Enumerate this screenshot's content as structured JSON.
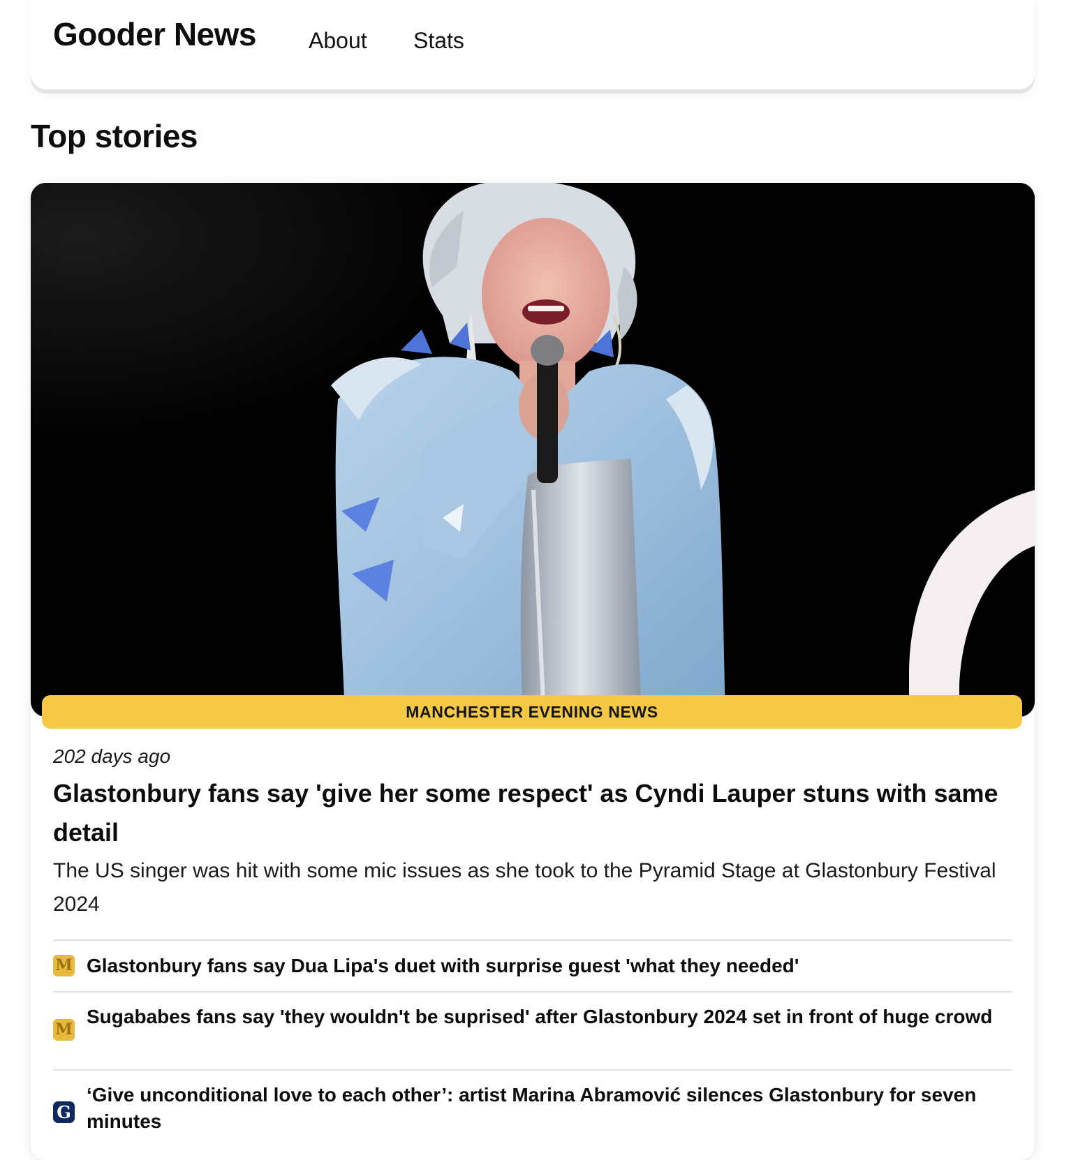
{
  "nav": {
    "brand": "Gooder News",
    "links": [
      "About",
      "Stats"
    ]
  },
  "section": {
    "title": "Top stories"
  },
  "story": {
    "source": "MANCHESTER EVENING NEWS",
    "age": "202 days ago",
    "headline": "Glastonbury fans say 'give her some respect' as Cyndi Lauper stuns with same detail",
    "summary": "The US singer was hit with some mic issues as she took to the Pyramid Stage at Glastonbury Festival 2024",
    "image_icon": "photo-singer-on-stage"
  },
  "related": [
    {
      "title": "Glastonbury fans say Dua Lipa's duet with surprise guest 'what they needed'",
      "favicon_letter": "M",
      "favicon_icon": "manchester-evening-news-favicon"
    },
    {
      "title": "Sugababes fans say 'they wouldn't be suprised' after Glastonbury 2024 set in front of huge crowd",
      "favicon_letter": "M",
      "favicon_icon": "manchester-evening-news-favicon"
    },
    {
      "title": "‘Give unconditional love to each other’: artist Marina Abramović silences Glastonbury for seven minutes",
      "favicon_letter": "G",
      "favicon_icon": "guardian-favicon"
    }
  ],
  "colors": {
    "source_banner": "#f5c945",
    "hero_background": "#000000",
    "men_favicon": "#e8b93a",
    "guardian_favicon": "#0f2a5e"
  }
}
